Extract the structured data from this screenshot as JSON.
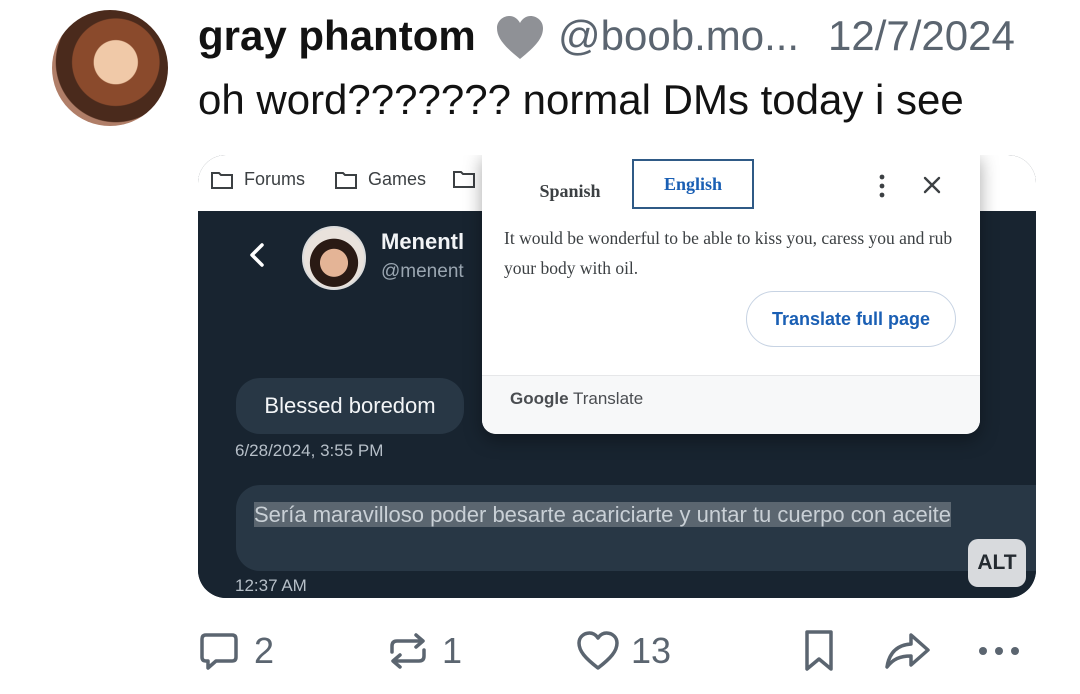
{
  "post": {
    "display_name": "gray phantom",
    "handle": "@boob.mo...",
    "timestamp": "12/7/2024",
    "text": "oh word??????? normal DMs today i see"
  },
  "embed": {
    "bookmarks": [
      "Forums",
      "Games",
      ""
    ],
    "contact_name": "Menentl",
    "contact_handle": "@menent",
    "messages": [
      {
        "text": "Blessed boredom",
        "time": "6/28/2024, 3:55 PM"
      },
      {
        "text": "Sería maravilloso poder besarte acariciarte y untar tu cuerpo con aceite",
        "time": "12:37 AM"
      }
    ],
    "translate": {
      "source_tab": "Spanish",
      "target_tab": "English",
      "translated_text": "It would be wonderful to be able to kiss you, caress you and rub your body with oil.",
      "full_page_button": "Translate full page",
      "brand_bold": "Google",
      "brand_rest": " Translate"
    },
    "alt_badge": "ALT"
  },
  "actions": {
    "replies": "2",
    "reposts": "1",
    "likes": "13"
  },
  "colors": {
    "muted": "#5b6570",
    "chat_bg": "#182430",
    "bubble": "#283745",
    "link_blue": "#1a5fb4"
  },
  "icons": [
    "heart-icon",
    "folder-icon",
    "back-icon",
    "more-vertical-icon",
    "close-icon",
    "reply-icon",
    "repost-icon",
    "like-icon",
    "bookmark-icon",
    "share-icon",
    "more-horizontal-icon"
  ]
}
